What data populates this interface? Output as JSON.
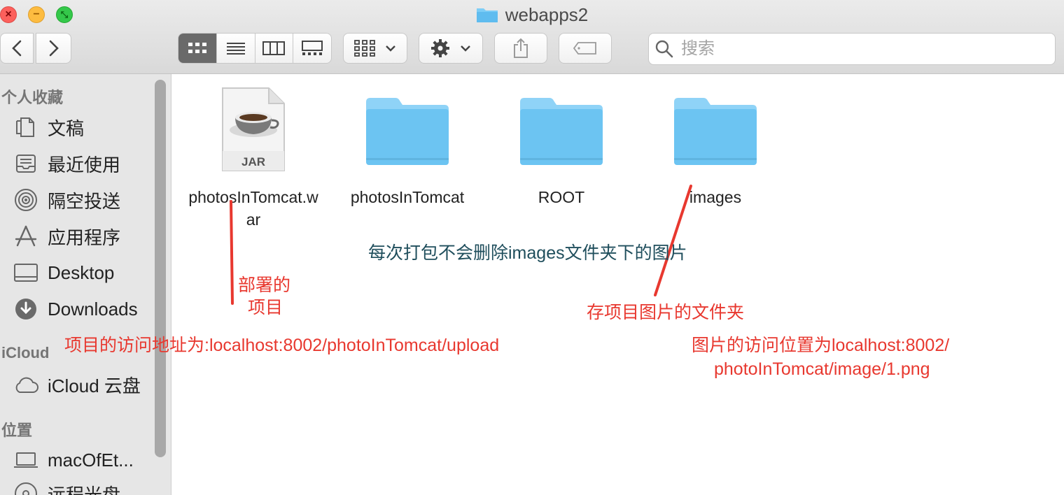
{
  "window": {
    "title": "webapps2",
    "close_glyph": "×",
    "minimize_glyph": "−",
    "maximize_glyph": "⤡"
  },
  "toolbar": {
    "back_icon": "chevron-left-icon",
    "forward_icon": "chevron-right-icon",
    "view_modes": [
      "icon-view",
      "list-view",
      "column-view",
      "gallery-view"
    ],
    "active_view": "icon-view",
    "search_placeholder": "搜索"
  },
  "sidebar": {
    "favorites_header": "个人收藏",
    "favorites": [
      {
        "label": "文稿",
        "icon": "document-icon"
      },
      {
        "label": "最近使用",
        "icon": "recents-icon"
      },
      {
        "label": "隔空投送",
        "icon": "airdrop-icon"
      },
      {
        "label": "应用程序",
        "icon": "applications-icon"
      },
      {
        "label": "Desktop",
        "icon": "desktop-icon"
      },
      {
        "label": "Downloads",
        "icon": "downloads-icon"
      }
    ],
    "icloud_header": "iCloud",
    "icloud": [
      {
        "label": "iCloud 云盘",
        "icon": "cloud-icon"
      }
    ],
    "locations_header": "位置",
    "locations": [
      {
        "label": "macOfEt...",
        "icon": "laptop-icon"
      },
      {
        "label": "远程光盘",
        "icon": "disc-icon"
      }
    ]
  },
  "files": [
    {
      "name": "photosInTomcat.w\nar",
      "line1": "photosInTomcat.w",
      "line2": "ar",
      "kind": "jar",
      "badge": "JAR"
    },
    {
      "name": "photosInTomcat",
      "kind": "folder"
    },
    {
      "name": "ROOT",
      "kind": "folder"
    },
    {
      "name": "images",
      "kind": "folder"
    }
  ],
  "annotations": {
    "deploy_line1": "部署的",
    "deploy_line2": "项目",
    "project_url": "项目的访问地址为:localhost:8002/photoInTomcat/upload",
    "note_center": "每次打包不会删除images文件夹下的图片",
    "images_folder": "存项目图片的文件夹",
    "image_url_line1": "图片的访问位置为localhost:8002/",
    "image_url_line2": "photoInTomcat/image/1.png"
  },
  "colors": {
    "annotation_red": "#e8382f",
    "annotation_teal": "#1f4e5c",
    "folder_blue": "#6cc4f2",
    "folder_tab": "#8fd3f7"
  }
}
